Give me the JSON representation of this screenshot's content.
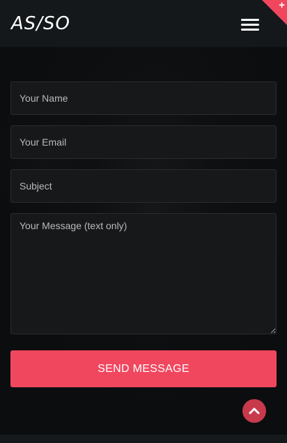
{
  "header": {
    "logo_text": "AS/SO",
    "menu_icon": "hamburger-menu-icon",
    "corner_icon": "plus-icon",
    "corner_symbol": "+",
    "accent_color": "#f0475f"
  },
  "form": {
    "name_placeholder": "Your Name",
    "email_placeholder": "Your Email",
    "subject_placeholder": "Subject",
    "message_placeholder": "Your Message (text only)",
    "name_value": "",
    "email_value": "",
    "subject_value": "",
    "message_value": "",
    "submit_label": "SEND MESSAGE"
  },
  "scroll_top": {
    "icon": "chevron-up-icon"
  }
}
